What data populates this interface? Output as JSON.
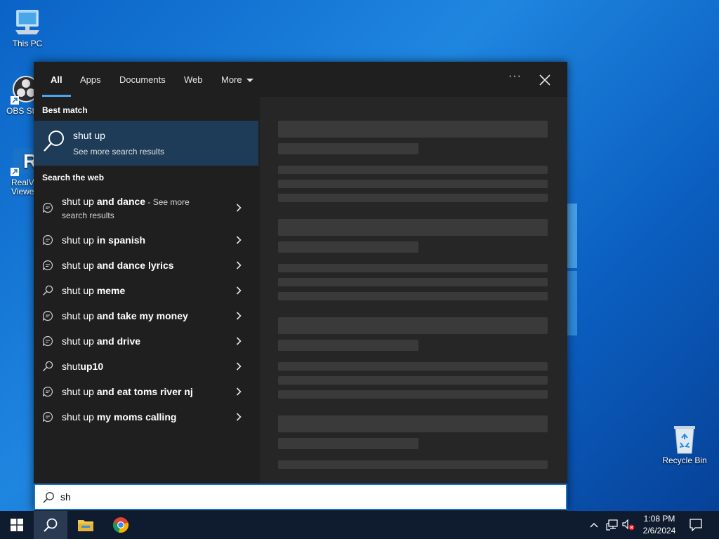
{
  "desktop": {
    "icons": [
      {
        "label": "This PC"
      },
      {
        "label": "OBS Stu"
      },
      {
        "label": "RealVN Viewe"
      },
      {
        "label": "Recycle Bin"
      }
    ]
  },
  "search_panel": {
    "tabs": [
      {
        "label": "All"
      },
      {
        "label": "Apps"
      },
      {
        "label": "Documents"
      },
      {
        "label": "Web"
      },
      {
        "label": "More"
      }
    ],
    "ellipsis": "···",
    "best_match_heading": "Best match",
    "best_match": {
      "title": "shut up",
      "subtitle": "See more search results"
    },
    "web_heading": "Search the web",
    "web_results": [
      {
        "prefix": "shut up",
        "bold": " and dance",
        "suffix": " - See more",
        "second_line": "search results",
        "icon": "chat-bubble-icon"
      },
      {
        "prefix": "shut up",
        "bold": " in spanish",
        "icon": "chat-bubble-icon"
      },
      {
        "prefix": "shut up",
        "bold": " and dance lyrics",
        "icon": "chat-bubble-icon"
      },
      {
        "prefix": "shut up",
        "bold": " meme",
        "icon": "search-icon"
      },
      {
        "prefix": "shut up",
        "bold": " and take my money",
        "icon": "chat-bubble-icon"
      },
      {
        "prefix": "shut up",
        "bold": " and drive",
        "icon": "chat-bubble-icon"
      },
      {
        "prefix": "shut",
        "bold": "up10",
        "icon": "search-icon"
      },
      {
        "prefix": "shut up",
        "bold": " and eat toms river nj",
        "icon": "chat-bubble-icon"
      },
      {
        "prefix": "shut up",
        "bold": " my moms calling",
        "icon": "chat-bubble-icon"
      }
    ]
  },
  "search_box": {
    "value": "sh"
  },
  "taskbar": {
    "time": "1:08 PM",
    "date": "2/6/2024"
  }
}
